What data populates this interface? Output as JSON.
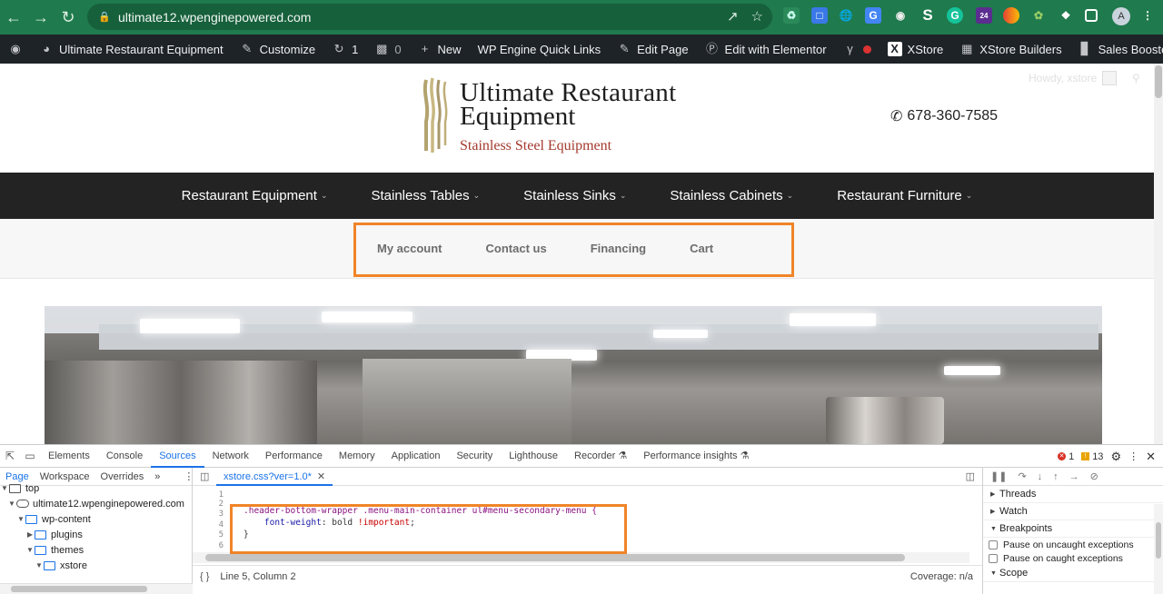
{
  "browser": {
    "url": "ultimate12.wpenginepowered.com",
    "profile_initial": "A",
    "ext_badge": "24"
  },
  "adminbar": {
    "site_name": "Ultimate Restaurant Equipment",
    "customize": "Customize",
    "updates_count": "1",
    "comments_count": "0",
    "new": "New",
    "quick_links": "WP Engine Quick Links",
    "edit_page": "Edit Page",
    "elementor": "Edit with Elementor",
    "xstore": "XStore",
    "xstore_builders": "XStore Builders",
    "sales_booster": "Sales Booster"
  },
  "site": {
    "logo_line1": "Ultimate Restaurant",
    "logo_line2": "Equipment",
    "logo_tagline": "Stainless Steel Equipment",
    "phone": "678-360-7585",
    "howdy": "Howdy, xstore",
    "main_menu": [
      "Restaurant Equipment",
      "Stainless Tables",
      "Stainless Sinks",
      "Stainless Cabinets",
      "Restaurant Furniture"
    ],
    "secondary_menu": [
      "My account",
      "Contact us",
      "Financing",
      "Cart"
    ]
  },
  "devtools": {
    "tabs": [
      "Elements",
      "Console",
      "Sources",
      "Network",
      "Performance",
      "Memory",
      "Application",
      "Security",
      "Lighthouse",
      "Recorder",
      "Performance insights"
    ],
    "active_tab": "Sources",
    "errors": "1",
    "warnings": "13",
    "nav_tabs": [
      "Page",
      "Workspace",
      "Overrides"
    ],
    "tree": [
      "top",
      "ultimate12.wpenginepowered.com",
      "wp-content",
      "plugins",
      "themes",
      "xstore"
    ],
    "file_tab": "xstore.css?ver=1.0*",
    "line_numbers": [
      "1",
      "2",
      "3",
      "4",
      "5",
      "6"
    ],
    "code_selector": ".header-bottom-wrapper .menu-main-container ul#menu-secondary-menu {",
    "code_property": "font-weight",
    "code_value": "bold",
    "code_important": "!important",
    "code_close": "}",
    "status": "Line 5, Column 2",
    "coverage": "Coverage: n/a",
    "debug_sections": [
      "Threads",
      "Watch",
      "Breakpoints",
      "Scope"
    ],
    "pause_uncaught": "Pause on uncaught exceptions",
    "pause_caught": "Pause on caught exceptions"
  },
  "colors": {
    "chrome_green": "#1f7a4d",
    "admin_bar": "#1d2327",
    "nav_dark": "#232323",
    "highlight_orange": "#f08428",
    "devtools_blue": "#1a73e8"
  }
}
